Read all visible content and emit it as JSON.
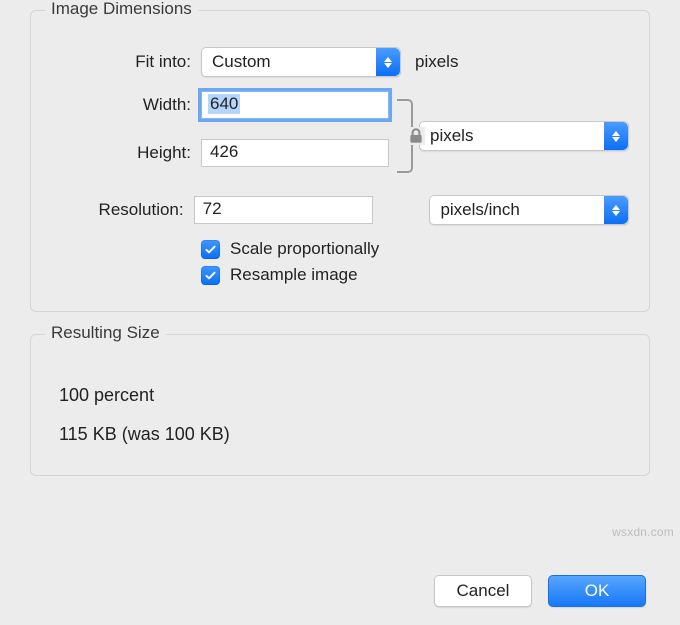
{
  "groups": {
    "dimensions_title": "Image Dimensions",
    "resulting_title": "Resulting Size"
  },
  "labels": {
    "fit_into": "Fit into:",
    "width": "Width:",
    "height": "Height:",
    "resolution": "Resolution:"
  },
  "fields": {
    "fit_into_value": "Custom",
    "fit_into_unit": "pixels",
    "width_value": "640",
    "height_value": "426",
    "wh_unit_value": "pixels",
    "resolution_value": "72",
    "resolution_unit_value": "pixels/inch"
  },
  "checkboxes": {
    "scale_label": "Scale proportionally",
    "scale_checked": true,
    "resample_label": "Resample image",
    "resample_checked": true
  },
  "result": {
    "percent_line": "100 percent",
    "size_line": "115 KB (was 100 KB)"
  },
  "buttons": {
    "cancel": "Cancel",
    "ok": "OK"
  },
  "watermark": "wsxdn.com",
  "colors": {
    "accent": "#1877f6"
  }
}
